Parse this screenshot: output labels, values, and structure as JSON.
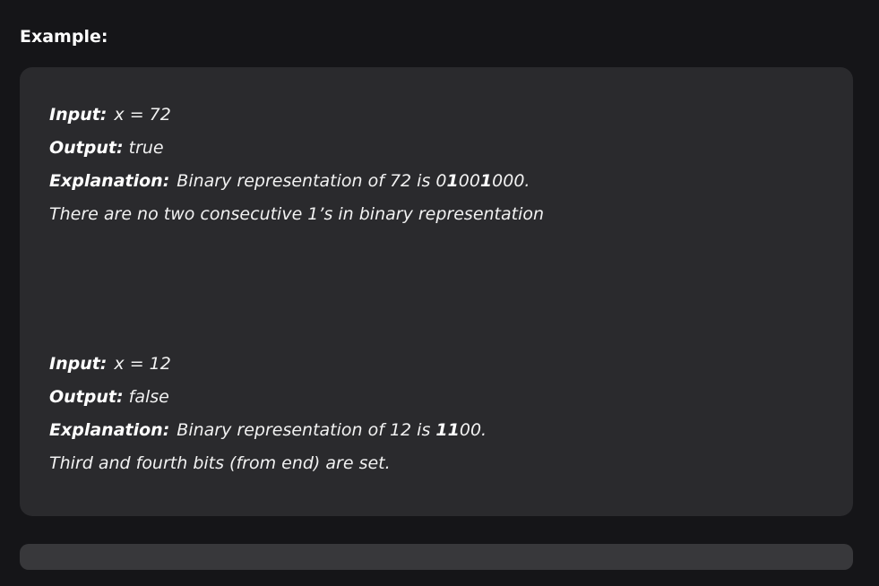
{
  "heading": "Example:",
  "examples": [
    {
      "input_label": "Input:",
      "input_value": "x = 72",
      "output_label": "Output:",
      "output_value": "true",
      "explanation_label": "Explanation:",
      "explanation_prefix": "Binary representation of 72 is",
      "binary_parts": [
        "0",
        "1",
        "00",
        "1",
        "000"
      ],
      "explanation_suffix": ".",
      "extra_line": "There are no two consecutive 1’s in binary representation"
    },
    {
      "input_label": "Input:",
      "input_value": "x = 12",
      "output_label": "Output:",
      "output_value": "false",
      "explanation_label": "Explanation:",
      "explanation_prefix": "Binary representation of 12 is",
      "binary_parts": [
        "11",
        "00"
      ],
      "explanation_suffix": ".",
      "extra_line": "Third and fourth bits (from end) are set."
    }
  ]
}
